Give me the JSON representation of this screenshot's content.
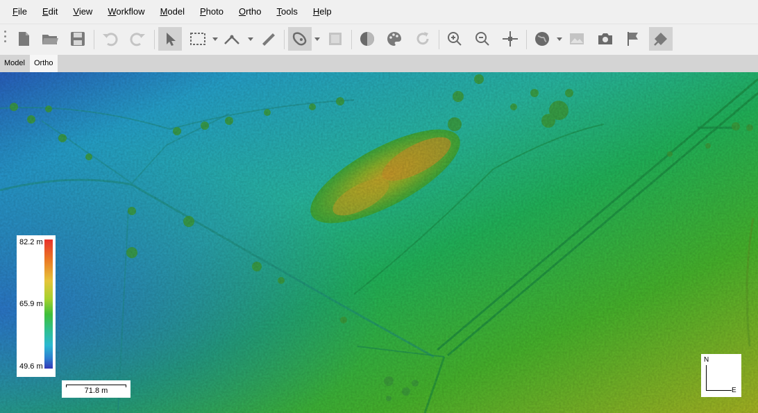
{
  "menu": [
    "File",
    "Edit",
    "View",
    "Workflow",
    "Model",
    "Photo",
    "Ortho",
    "Tools",
    "Help"
  ],
  "toolbar": {
    "icons": [
      "new-document-icon",
      "open-folder-icon",
      "save-icon",
      "undo-icon",
      "redo-icon",
      "navigation-pointer-icon",
      "rectangle-selection-icon",
      "ruler-icon",
      "measure-icon",
      "draw-polygon-icon",
      "image-overlay-icon",
      "contrast-icon",
      "palette-icon",
      "refresh-icon",
      "zoom-in-icon",
      "zoom-out-icon",
      "reset-view-icon",
      "globe-icon",
      "mosaic-icon",
      "camera-icon",
      "flag-icon",
      "mark-icon"
    ],
    "active": [
      "navigation-pointer-icon",
      "draw-polygon-icon",
      "mark-icon"
    ]
  },
  "tabs": [
    {
      "label": "Model"
    },
    {
      "label": "Ortho",
      "selected": true
    }
  ],
  "legend": {
    "max": "82.2 m",
    "mid": "65.9 m",
    "min": "49.6 m"
  },
  "scale": {
    "label": "71.8 m"
  },
  "compass": {
    "north": "N",
    "east": "E"
  },
  "colors": {
    "low": "#2c62c0",
    "mid": "#22b24c",
    "high": "#e24a2a",
    "toolbar_bg": "#f0f0f0",
    "tabbar_bg": "#d4d4d4"
  }
}
